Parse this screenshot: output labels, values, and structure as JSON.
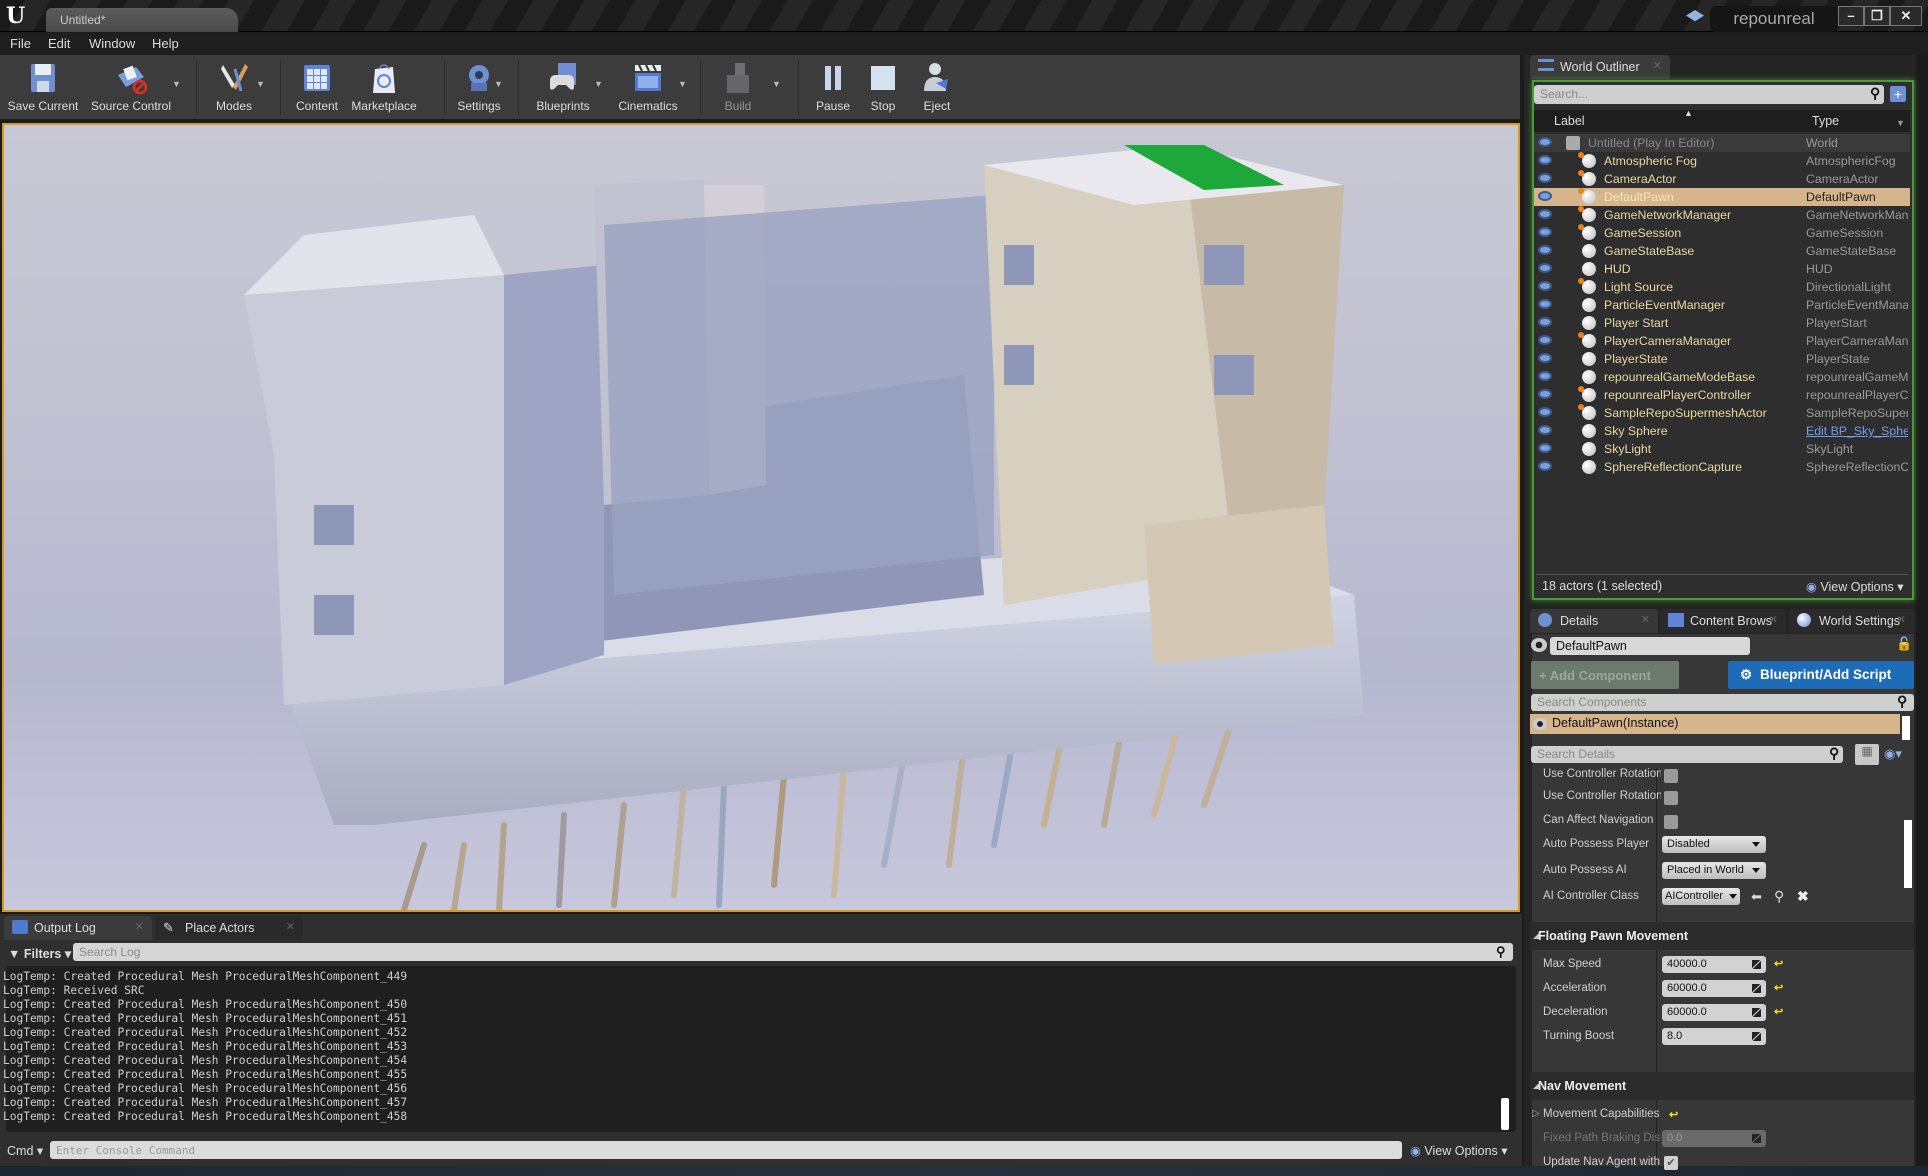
{
  "window": {
    "doc_tab": "Untitled*",
    "project_name": "repounreal",
    "minimize": "–",
    "restore": "❐",
    "close": "✕"
  },
  "menu": [
    "File",
    "Edit",
    "Window",
    "Help"
  ],
  "toolbar": [
    {
      "label": "Save Current",
      "icon": "save-icon",
      "dropdown": false
    },
    {
      "label": "Source Control",
      "icon": "source-control-icon",
      "dropdown": true
    },
    {
      "label": "Modes",
      "icon": "modes-icon",
      "dropdown": true
    },
    {
      "label": "Content",
      "icon": "content-icon",
      "dropdown": false
    },
    {
      "label": "Marketplace",
      "icon": "marketplace-icon",
      "dropdown": false
    },
    {
      "label": "Settings",
      "icon": "settings-icon",
      "dropdown": true
    },
    {
      "label": "Blueprints",
      "icon": "blueprints-icon",
      "dropdown": true
    },
    {
      "label": "Cinematics",
      "icon": "cinematics-icon",
      "dropdown": true
    },
    {
      "label": "Build",
      "icon": "build-icon",
      "dropdown": true
    },
    {
      "label": "Pause",
      "icon": "pause-icon",
      "dropdown": false
    },
    {
      "label": "Stop",
      "icon": "stop-icon",
      "dropdown": false
    },
    {
      "label": "Eject",
      "icon": "eject-icon",
      "dropdown": false
    }
  ],
  "bottom_panel": {
    "tabs": [
      {
        "label": "Output Log"
      },
      {
        "label": "Place Actors"
      }
    ],
    "filters_label": "Filters",
    "search_placeholder": "Search Log",
    "log_lines": [
      "LogTemp: Created Procedural Mesh ProceduralMeshComponent_449",
      "LogTemp: Received SRC",
      "LogTemp: Created Procedural Mesh ProceduralMeshComponent_450",
      "LogTemp: Created Procedural Mesh ProceduralMeshComponent_451",
      "LogTemp: Created Procedural Mesh ProceduralMeshComponent_452",
      "LogTemp: Created Procedural Mesh ProceduralMeshComponent_453",
      "LogTemp: Created Procedural Mesh ProceduralMeshComponent_454",
      "LogTemp: Created Procedural Mesh ProceduralMeshComponent_455",
      "LogTemp: Created Procedural Mesh ProceduralMeshComponent_456",
      "LogTemp: Created Procedural Mesh ProceduralMeshComponent_457",
      "LogTemp: Created Procedural Mesh ProceduralMeshComponent_458"
    ],
    "cmd_label": "Cmd",
    "cmd_placeholder": "Enter Console Command",
    "view_options": "View Options"
  },
  "outliner": {
    "tab": "World Outliner",
    "search_placeholder": "Search...",
    "col_label": "Label",
    "col_type": "Type",
    "rows": [
      {
        "label": "Untitled (Play In Editor)",
        "type": "World",
        "world": true
      },
      {
        "label": "Atmospheric Fog",
        "type": "AtmosphericFog",
        "dot": true
      },
      {
        "label": "CameraActor",
        "type": "CameraActor",
        "dot": true
      },
      {
        "label": "DefaultPawn",
        "type": "DefaultPawn",
        "dot": true,
        "selected": true
      },
      {
        "label": "GameNetworkManager",
        "type": "GameNetworkManager",
        "dot": true
      },
      {
        "label": "GameSession",
        "type": "GameSession",
        "dot": true
      },
      {
        "label": "GameStateBase",
        "type": "GameStateBase"
      },
      {
        "label": "HUD",
        "type": "HUD"
      },
      {
        "label": "Light Source",
        "type": "DirectionalLight",
        "dot": true
      },
      {
        "label": "ParticleEventManager",
        "type": "ParticleEventManager"
      },
      {
        "label": "Player Start",
        "type": "PlayerStart"
      },
      {
        "label": "PlayerCameraManager",
        "type": "PlayerCameraManager",
        "dot": true
      },
      {
        "label": "PlayerState",
        "type": "PlayerState"
      },
      {
        "label": "repounrealGameModeBase",
        "type": "repounrealGameModeBase"
      },
      {
        "label": "repounrealPlayerController",
        "type": "repounrealPlayerController",
        "dot": true
      },
      {
        "label": "SampleRepoSupermeshActor",
        "type": "SampleRepoSupermeshActor",
        "dot": true
      },
      {
        "label": "Sky Sphere",
        "type": "Edit BP_Sky_Sphere",
        "link": true
      },
      {
        "label": "SkyLight",
        "type": "SkyLight"
      },
      {
        "label": "SphereReflectionCapture",
        "type": "SphereReflectionCapture"
      }
    ],
    "footer_count": "18 actors (1 selected)",
    "view_options": "View Options"
  },
  "details": {
    "tabs": [
      {
        "label": "Details"
      },
      {
        "label": "Content Brows"
      },
      {
        "label": "World Settings"
      }
    ],
    "name_value": "DefaultPawn",
    "add_component": "+ Add Component",
    "blueprint_button": "Blueprint/Add Script",
    "search_components_placeholder": "Search Components",
    "instance_label": "DefaultPawn(Instance)",
    "search_details_placeholder": "Search Details",
    "properties": [
      {
        "label": "Use Controller Rotation",
        "kind": "check",
        "checked": false
      },
      {
        "label": "Use Controller Rotation",
        "kind": "check",
        "checked": false
      },
      {
        "label": "Can Affect Navigation",
        "kind": "check",
        "checked": false
      },
      {
        "label": "Auto Possess Player",
        "kind": "select",
        "value": "Disabled"
      },
      {
        "label": "Auto Possess AI",
        "kind": "select",
        "value": "Placed in World"
      },
      {
        "label": "AI Controller Class",
        "kind": "class",
        "value": "AIController"
      }
    ],
    "sections": [
      {
        "title": "Floating Pawn Movement",
        "rows": [
          {
            "label": "Max Speed",
            "value": "40000.0",
            "reset": true
          },
          {
            "label": "Acceleration",
            "value": "60000.0",
            "reset": true
          },
          {
            "label": "Deceleration",
            "value": "60000.0",
            "reset": true
          },
          {
            "label": "Turning Boost",
            "value": "8.0",
            "reset": false
          }
        ]
      },
      {
        "title": "Nav Movement",
        "rows": [
          {
            "label": "Movement Capabilities",
            "kind": "expander",
            "reset": true
          },
          {
            "label": "Fixed Path Braking Distance",
            "value": "0.0",
            "disabled": true
          },
          {
            "label": "Update Nav Agent with Owner's Collision",
            "kind": "check",
            "checked": true
          }
        ]
      }
    ]
  },
  "colors": {
    "accent_selection": "#d6b58c",
    "viewport_border": "#d89a16",
    "outliner_focus": "#4d9a3a",
    "blueprint_button": "#1e6bb8",
    "reset_arrow": "#f0e020",
    "label_yellow": "#e8d9a0"
  }
}
